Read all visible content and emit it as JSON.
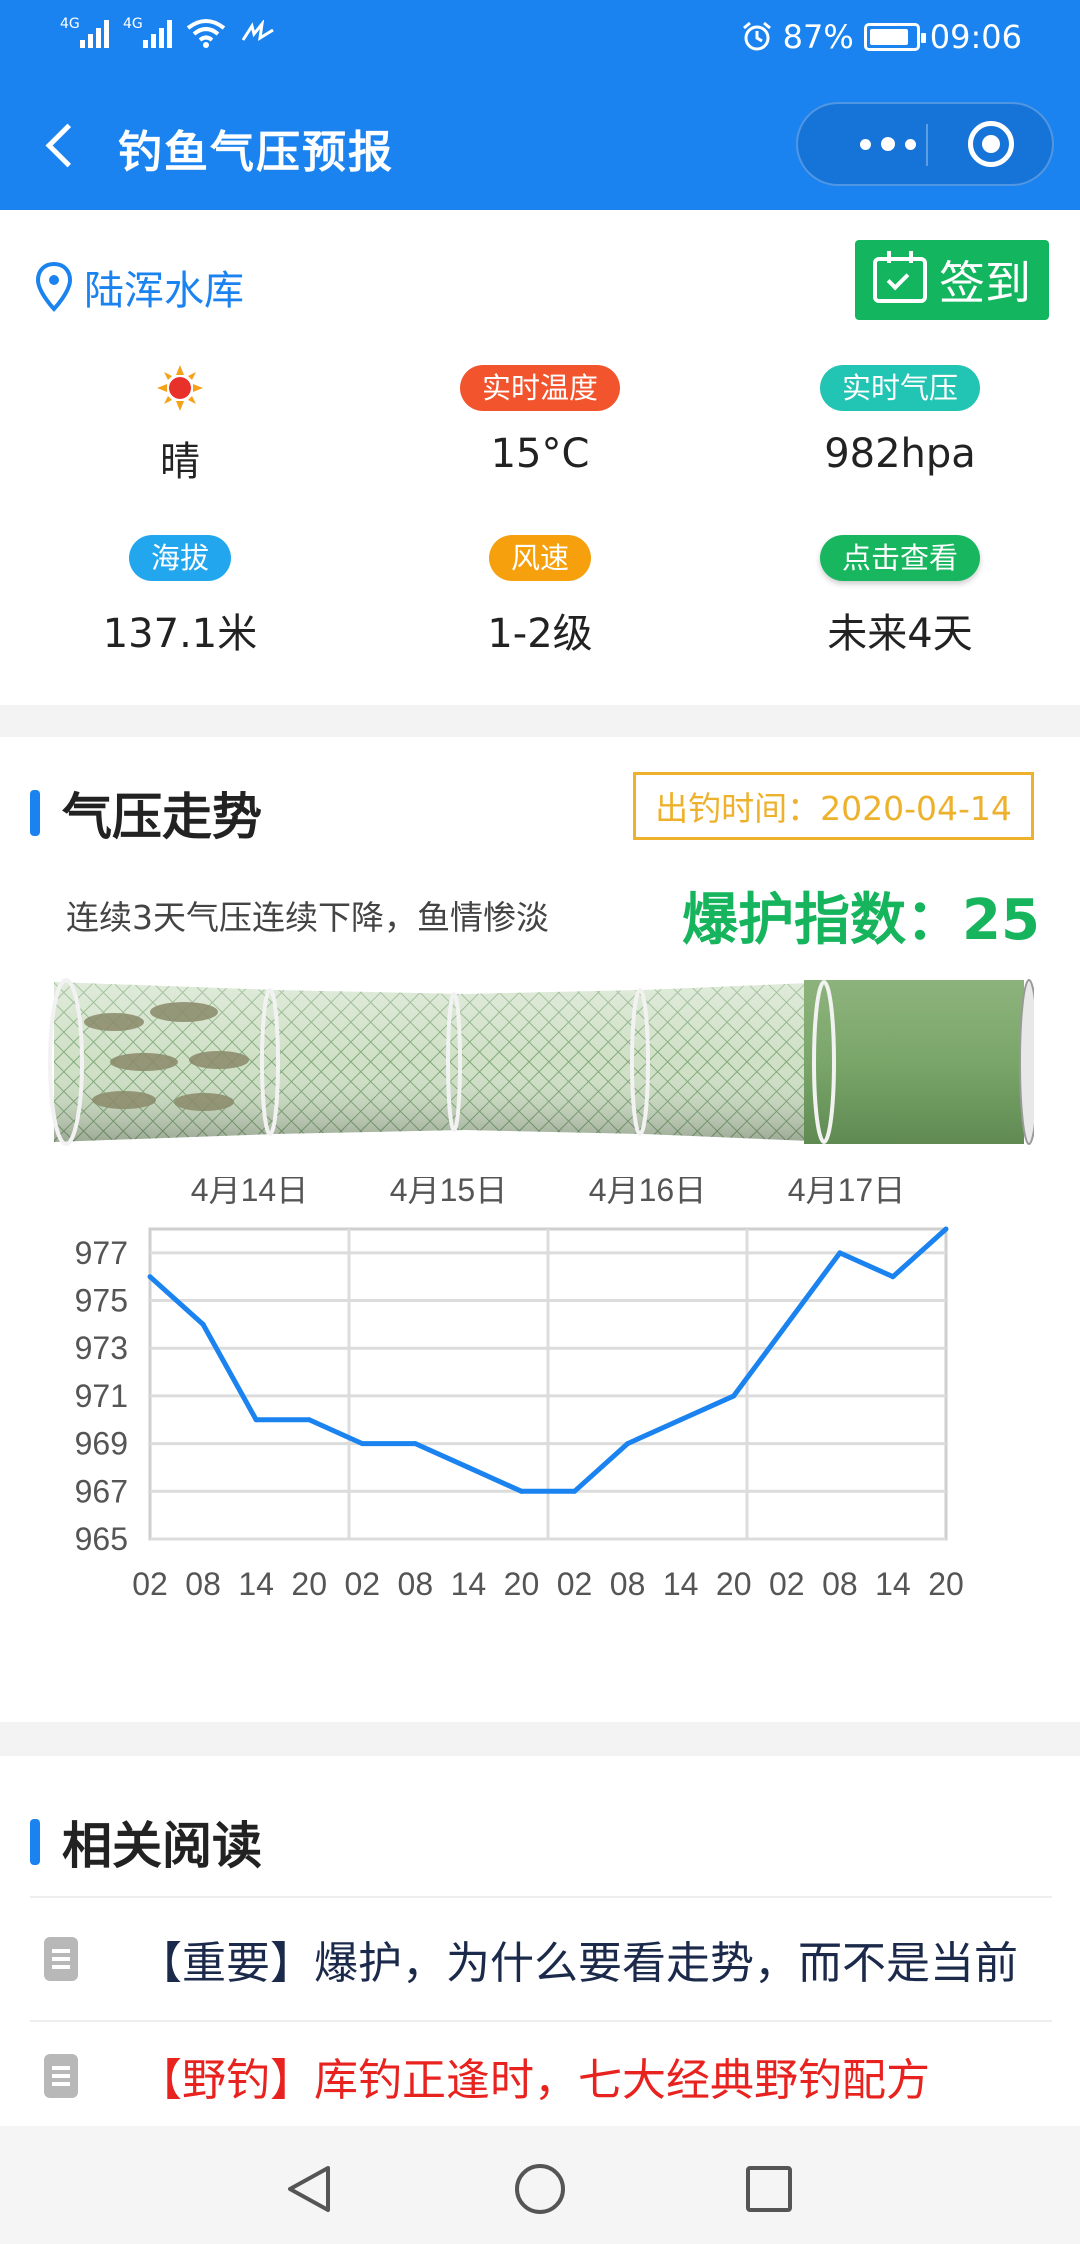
{
  "status": {
    "network1": "4G",
    "network2": "4G",
    "battery": "87%",
    "time": "09:06",
    "battery_level": 0.87
  },
  "nav": {
    "title": "钓鱼气压预报"
  },
  "location": {
    "name": "陆浑水库",
    "checkin_label": "签到"
  },
  "weather": {
    "condition": "晴",
    "temp_label": "实时温度",
    "temp_value": "15°C",
    "pressure_label": "实时气压",
    "pressure_value": "982hpa",
    "altitude_label": "海拔",
    "altitude_value": "137.1米",
    "wind_label": "风速",
    "wind_value": "1-2级",
    "forecast_label": "点击查看",
    "forecast_value": "未来4天"
  },
  "trend": {
    "title": "气压走势",
    "fishing_time": "出钓时间：2020-04-14",
    "description": "连续3天气压连续下降，鱼情惨淡",
    "index_label": "爆护指数：25",
    "index_value": 25
  },
  "chart_data": {
    "type": "line",
    "day_labels": [
      "4月14日",
      "4月15日",
      "4月16日",
      "4月17日"
    ],
    "categories": [
      "02",
      "08",
      "14",
      "20",
      "02",
      "08",
      "14",
      "20",
      "02",
      "08",
      "14",
      "20",
      "02",
      "08",
      "14",
      "20"
    ],
    "values": [
      976,
      974,
      970,
      970,
      969,
      969,
      968,
      967,
      967,
      969,
      970,
      971,
      974,
      977,
      976,
      978
    ],
    "y_ticks": [
      965,
      967,
      969,
      971,
      973,
      975,
      977
    ],
    "ylim": [
      965,
      978
    ],
    "grid": true,
    "color": "#1a83f0"
  },
  "reading": {
    "title": "相关阅读",
    "articles": [
      {
        "text": "【重要】爆护，为什么要看走势，而不是当前",
        "color": "#1b2a4a"
      },
      {
        "text": "【野钓】库钓正逢时，七大经典野钓配方",
        "color": "#e8231f"
      }
    ]
  },
  "colors": {
    "primary": "#1a83f0",
    "green": "#16b45c",
    "orange": "#eeb12c",
    "red": "#f2552e",
    "teal": "#22c4b3",
    "blue_pill": "#22a7ef",
    "amber_pill": "#f5a00c",
    "green_pill": "#18b75f"
  }
}
